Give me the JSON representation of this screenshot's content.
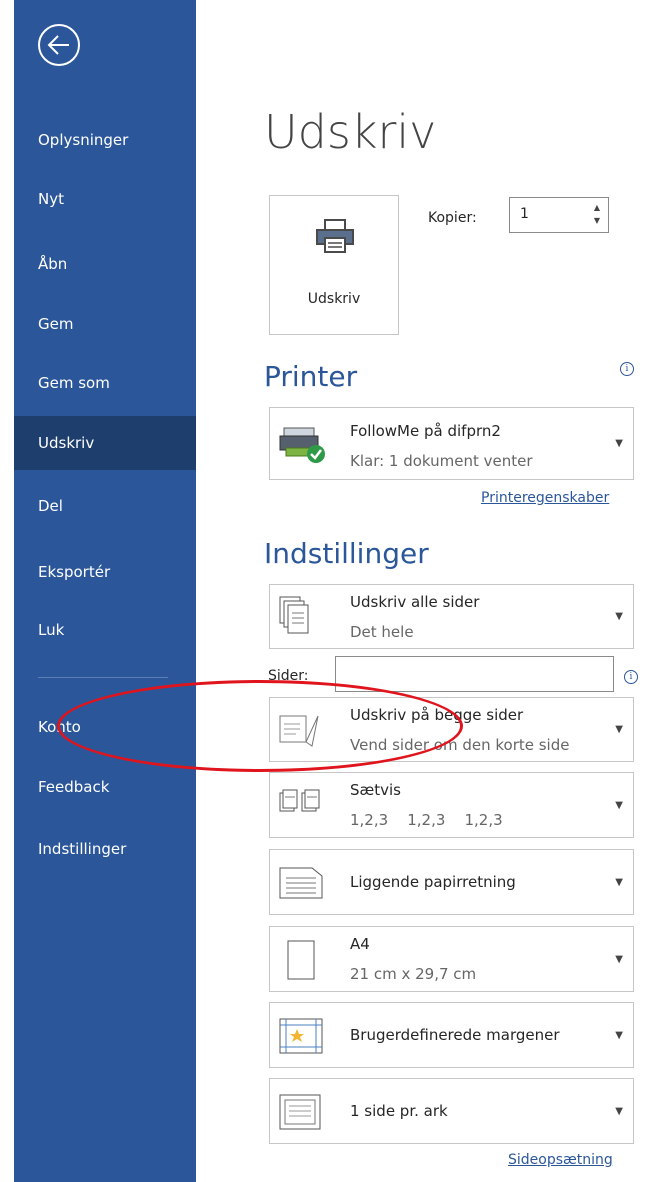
{
  "sidebar": {
    "items": [
      {
        "label": "Oplysninger"
      },
      {
        "label": "Nyt"
      },
      {
        "label": "Åbn"
      },
      {
        "label": "Gem"
      },
      {
        "label": "Gem som"
      },
      {
        "label": "Udskriv"
      },
      {
        "label": "Del"
      },
      {
        "label": "Eksportér"
      },
      {
        "label": "Luk"
      },
      {
        "label": "Konto"
      },
      {
        "label": "Feedback"
      },
      {
        "label": "Indstillinger"
      }
    ]
  },
  "main": {
    "title": "Udskriv",
    "print_button": "Udskriv",
    "copies_label": "Kopier:",
    "copies_value": "1",
    "printer_heading": "Printer",
    "printer_name": "FollowMe på difprn2",
    "printer_status": "Klar: 1 dokument venter",
    "printer_props_link": "Printeregenskaber",
    "settings_heading": "Indstillinger",
    "pages_label": "Sider:",
    "page_setup_link": "Sideopsætning",
    "settings": [
      {
        "line1": "Udskriv alle sider",
        "line2": "Det hele"
      },
      {
        "line1": "Udskriv på begge sider",
        "line2": "Vend sider om den korte side"
      },
      {
        "line1": "Sætvis",
        "line2": "1,2,3    1,2,3    1,2,3"
      },
      {
        "line1": "Liggende papirretning",
        "line2": ""
      },
      {
        "line1": "A4",
        "line2": "21 cm x 29,7 cm"
      },
      {
        "line1": "Brugerdefinerede margener",
        "line2": ""
      },
      {
        "line1": "1 side pr. ark",
        "line2": ""
      }
    ]
  },
  "colors": {
    "sidebar": "#2b579a",
    "active": "#1e3f6e",
    "annotation": "#e0141c"
  }
}
